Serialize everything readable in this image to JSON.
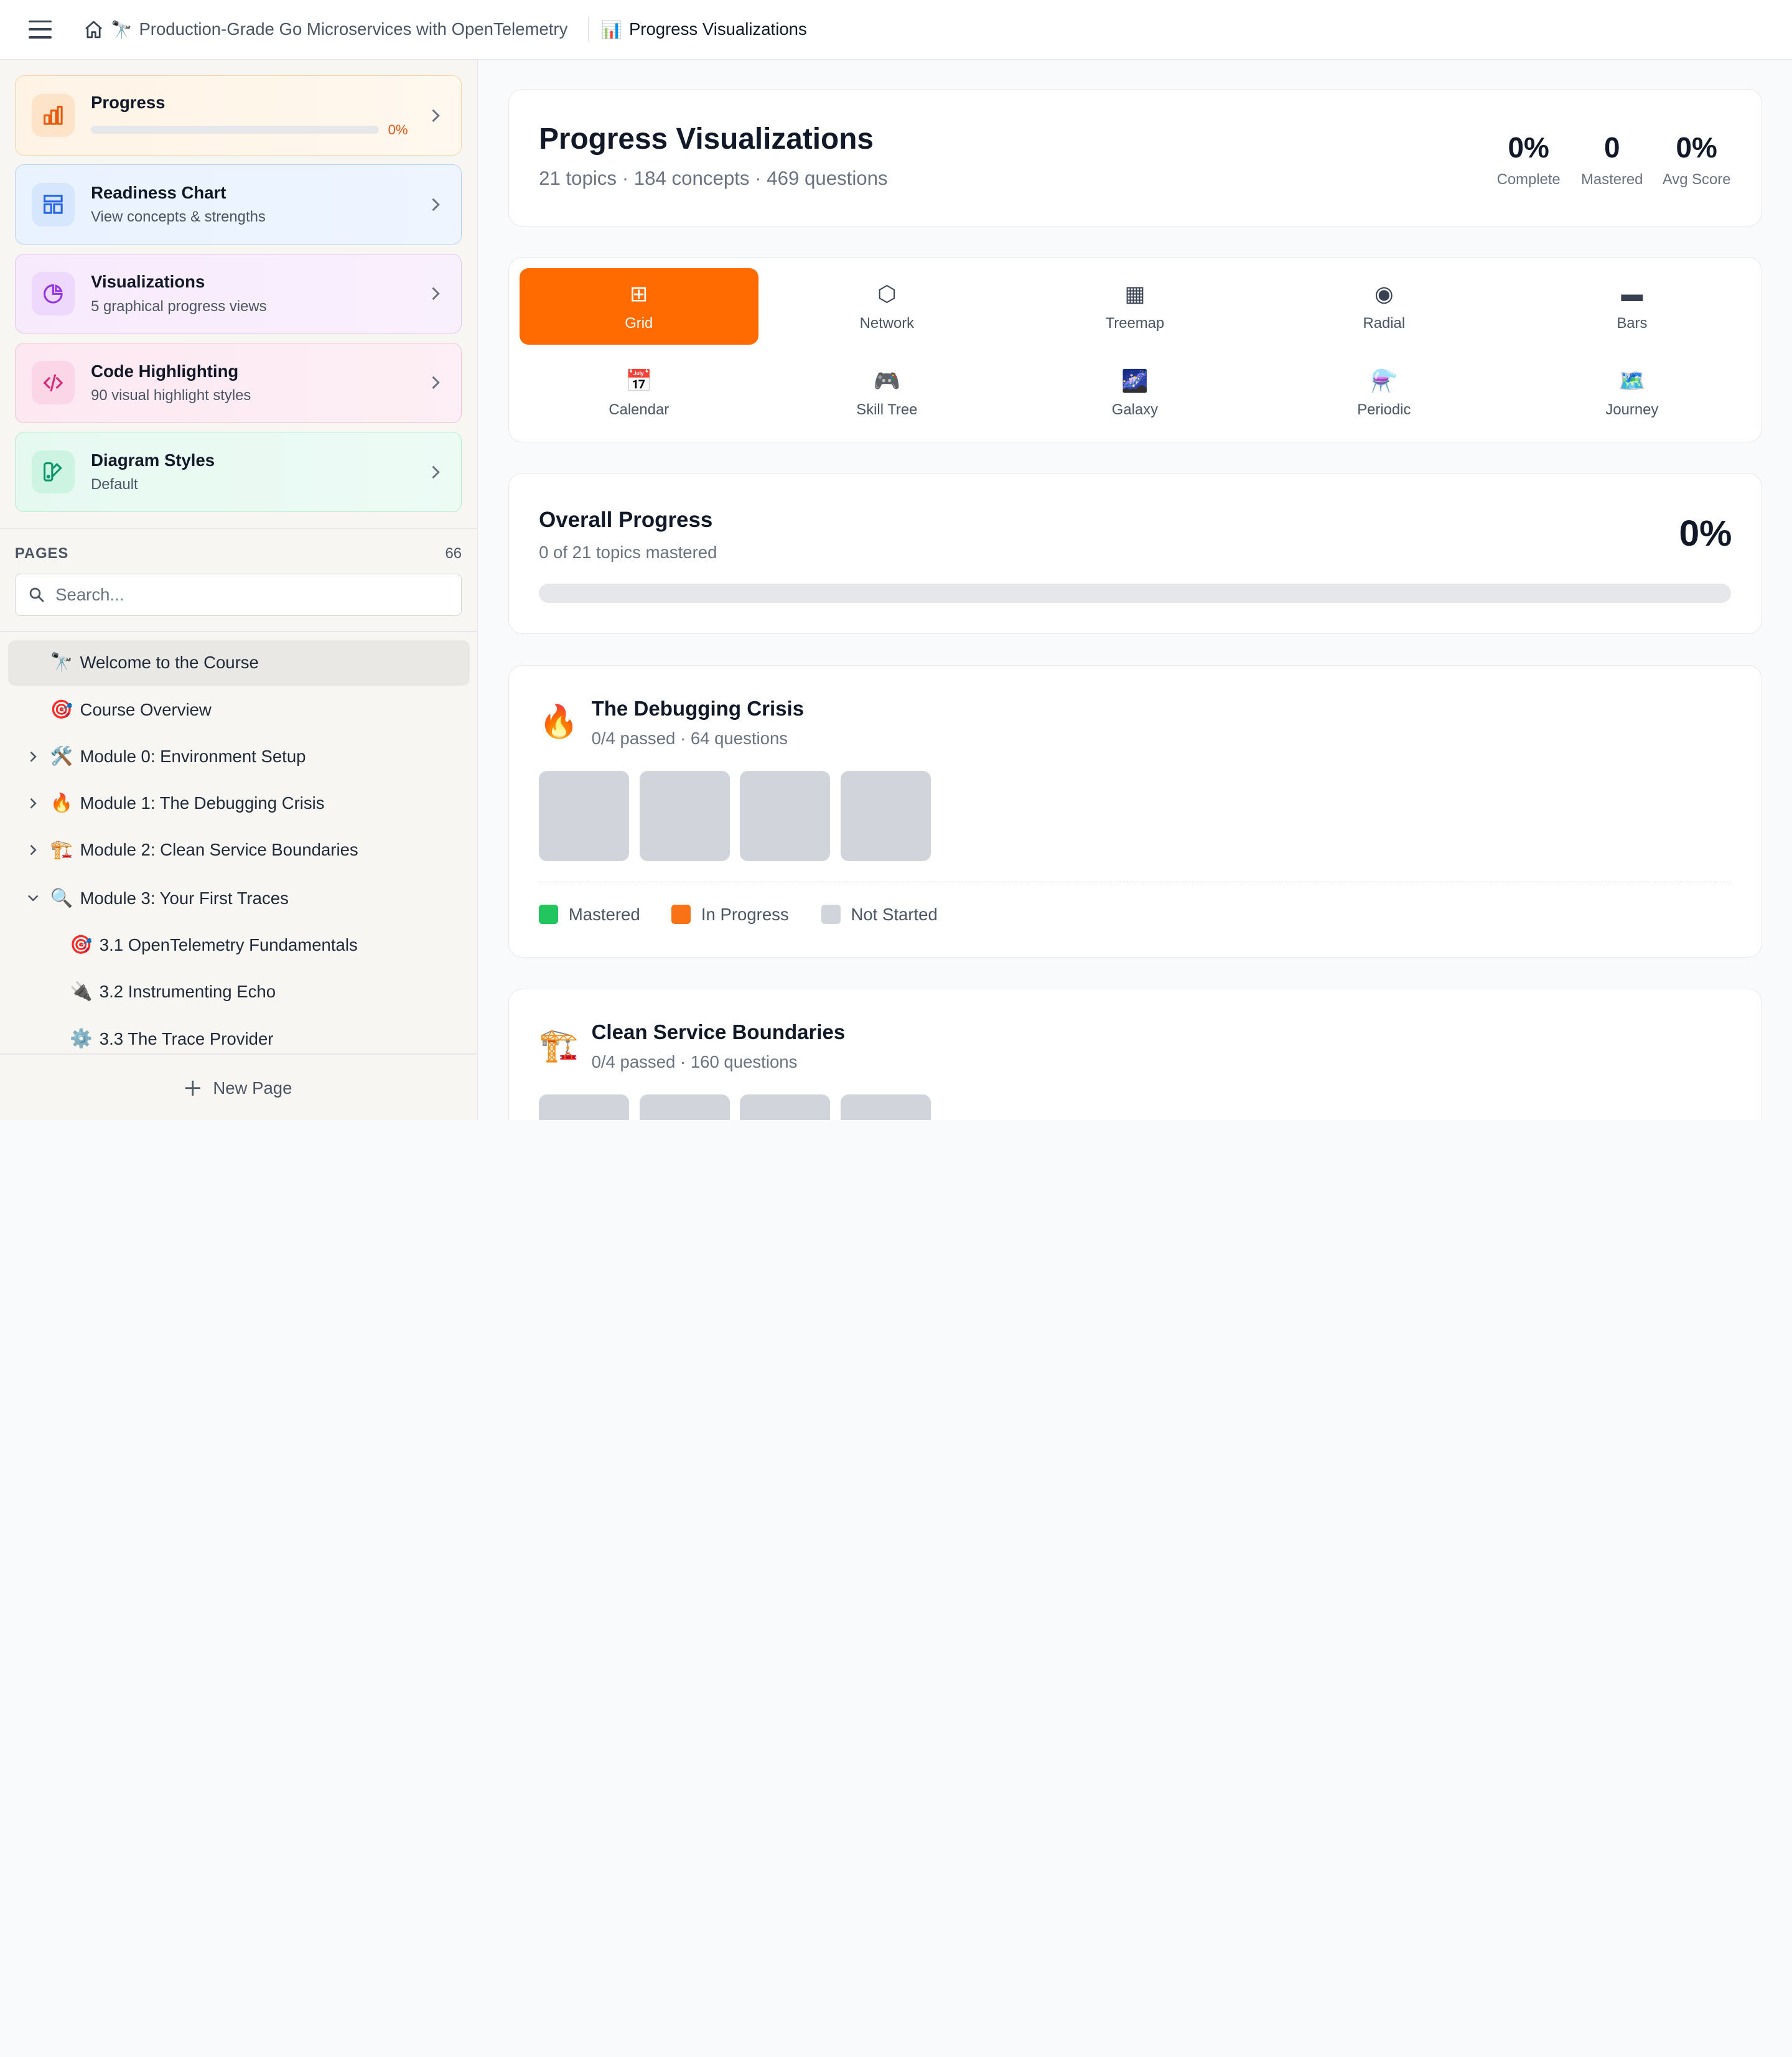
{
  "colors": {
    "accent": "#ff6b00",
    "mastered": "#22c55e",
    "in_progress": "#f97316",
    "not_started": "#d1d5db"
  },
  "header": {
    "menu_icon": "hamburger-icon",
    "home_icon": "home-icon",
    "course_emoji": "🔭",
    "course_title": "Production-Grade Go Microservices with OpenTelemetry",
    "page_emoji": "📊",
    "page_title": "Progress Visualizations"
  },
  "sidebar": {
    "cards": [
      {
        "title": "Progress",
        "pct": "0%",
        "icon": "bar-chart-icon",
        "progress": 0
      },
      {
        "title": "Readiness Chart",
        "subtitle": "View concepts & strengths",
        "icon": "layout-icon"
      },
      {
        "title": "Visualizations",
        "subtitle": "5 graphical progress views",
        "icon": "pie-chart-icon"
      },
      {
        "title": "Code Highlighting",
        "subtitle": "90 visual highlight styles",
        "icon": "code-icon"
      },
      {
        "title": "Diagram Styles",
        "subtitle": "Default",
        "icon": "palette-icon"
      }
    ],
    "pages_label": "PAGES",
    "pages_count": "66",
    "search_placeholder": "Search...",
    "tree": [
      {
        "emoji": "🔭",
        "label": "Welcome to the Course",
        "active": true
      },
      {
        "emoji": "🎯",
        "label": "Course Overview"
      },
      {
        "emoji": "🛠️",
        "label": "Module 0: Environment Setup",
        "caret": "right"
      },
      {
        "emoji": "🔥",
        "label": "Module 1: The Debugging Crisis",
        "caret": "right"
      },
      {
        "emoji": "🏗️",
        "label": "Module 2: Clean Service Boundaries",
        "caret": "right"
      },
      {
        "emoji": "🔍",
        "label": "Module 3: Your First Traces",
        "caret": "down"
      },
      {
        "emoji": "🎯",
        "label": "3.1 OpenTelemetry Fundamentals",
        "indent": 1
      },
      {
        "emoji": "🔌",
        "label": "3.2 Instrumenting Echo",
        "indent": 1
      },
      {
        "emoji": "⚙️",
        "label": "3.3 The Trace Provider",
        "indent": 1
      }
    ],
    "new_page_label": "New Page"
  },
  "main": {
    "title": "Progress Visualizations",
    "subtitle": "21 topics · 184 concepts · 469 questions",
    "stats": [
      {
        "value": "0%",
        "label": "Complete"
      },
      {
        "value": "0",
        "label": "Mastered"
      },
      {
        "value": "0%",
        "label": "Avg Score"
      }
    ],
    "tabs": [
      {
        "label": "Grid",
        "glyph": "⊞",
        "active": true
      },
      {
        "label": "Network",
        "glyph": "⬡"
      },
      {
        "label": "Treemap",
        "glyph": "▦"
      },
      {
        "label": "Radial",
        "glyph": "◉"
      },
      {
        "label": "Bars",
        "glyph": "▬"
      },
      {
        "label": "Calendar",
        "glyph": "📅"
      },
      {
        "label": "Skill Tree",
        "glyph": "🎮"
      },
      {
        "label": "Galaxy",
        "glyph": "🌌"
      },
      {
        "label": "Periodic",
        "glyph": "⚗️"
      },
      {
        "label": "Journey",
        "glyph": "🗺️"
      }
    ],
    "overall": {
      "title": "Overall Progress",
      "subtitle": "0 of 21 topics mastered",
      "pct": "0%",
      "progress": 0
    },
    "topics": [
      {
        "emoji": "🔥",
        "title": "The Debugging Crisis",
        "subtitle": "0/4 passed · 64 questions",
        "tiles": 4
      },
      {
        "emoji": "🏗️",
        "title": "Clean Service Boundaries",
        "subtitle": "0/4 passed · 160 questions",
        "tiles": 4
      }
    ],
    "legend": [
      "Mastered",
      "In Progress",
      "Not Started"
    ]
  }
}
